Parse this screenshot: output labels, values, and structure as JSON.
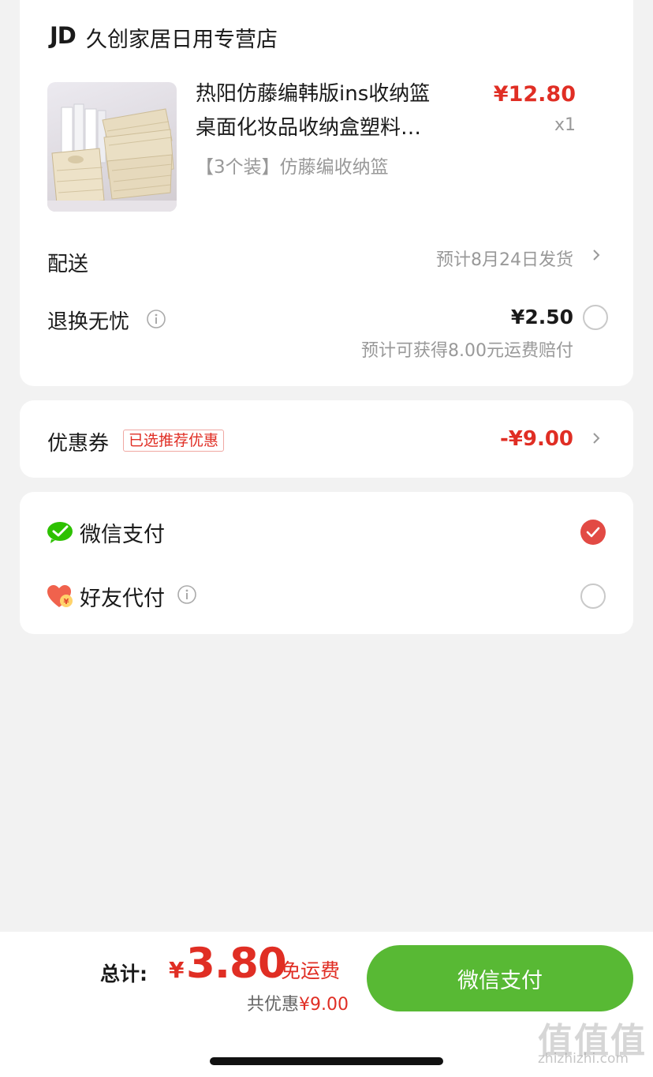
{
  "store": {
    "logo": "JD",
    "name": "久创家居日用专营店"
  },
  "product": {
    "title_line1": "热阳仿藤编韩版ins收纳篮",
    "title_line2": "桌面化妆品收纳盒塑料…",
    "price": "¥12.80",
    "quantity": "x1",
    "spec": "【3个装】仿藤编收纳篮"
  },
  "delivery": {
    "label": "配送",
    "value": "预计8月24日发货"
  },
  "return_insurance": {
    "label": "退换无忧",
    "price": "¥2.50",
    "subtext": "预计可获得8.00元运费赔付"
  },
  "coupon": {
    "label": "优惠券",
    "badge": "已选推荐优惠",
    "amount": "-¥9.00"
  },
  "payment": {
    "wechat_label": "微信支付",
    "wechat_selected": true,
    "friend_label": "好友代付",
    "friend_selected": false
  },
  "bottom": {
    "total_label": "总计:",
    "currency": "¥",
    "total_amount": "3.80",
    "free_shipping": "免运费",
    "saved_prefix": "共优惠",
    "saved_amount": "¥9.00",
    "pay_button": "微信支付"
  },
  "watermark": {
    "text": "值值值",
    "url": "zhizhizhi.com"
  },
  "colors": {
    "accent_red": "#e02e24",
    "pay_green": "#58b934",
    "wechat_green": "#2dc100"
  }
}
